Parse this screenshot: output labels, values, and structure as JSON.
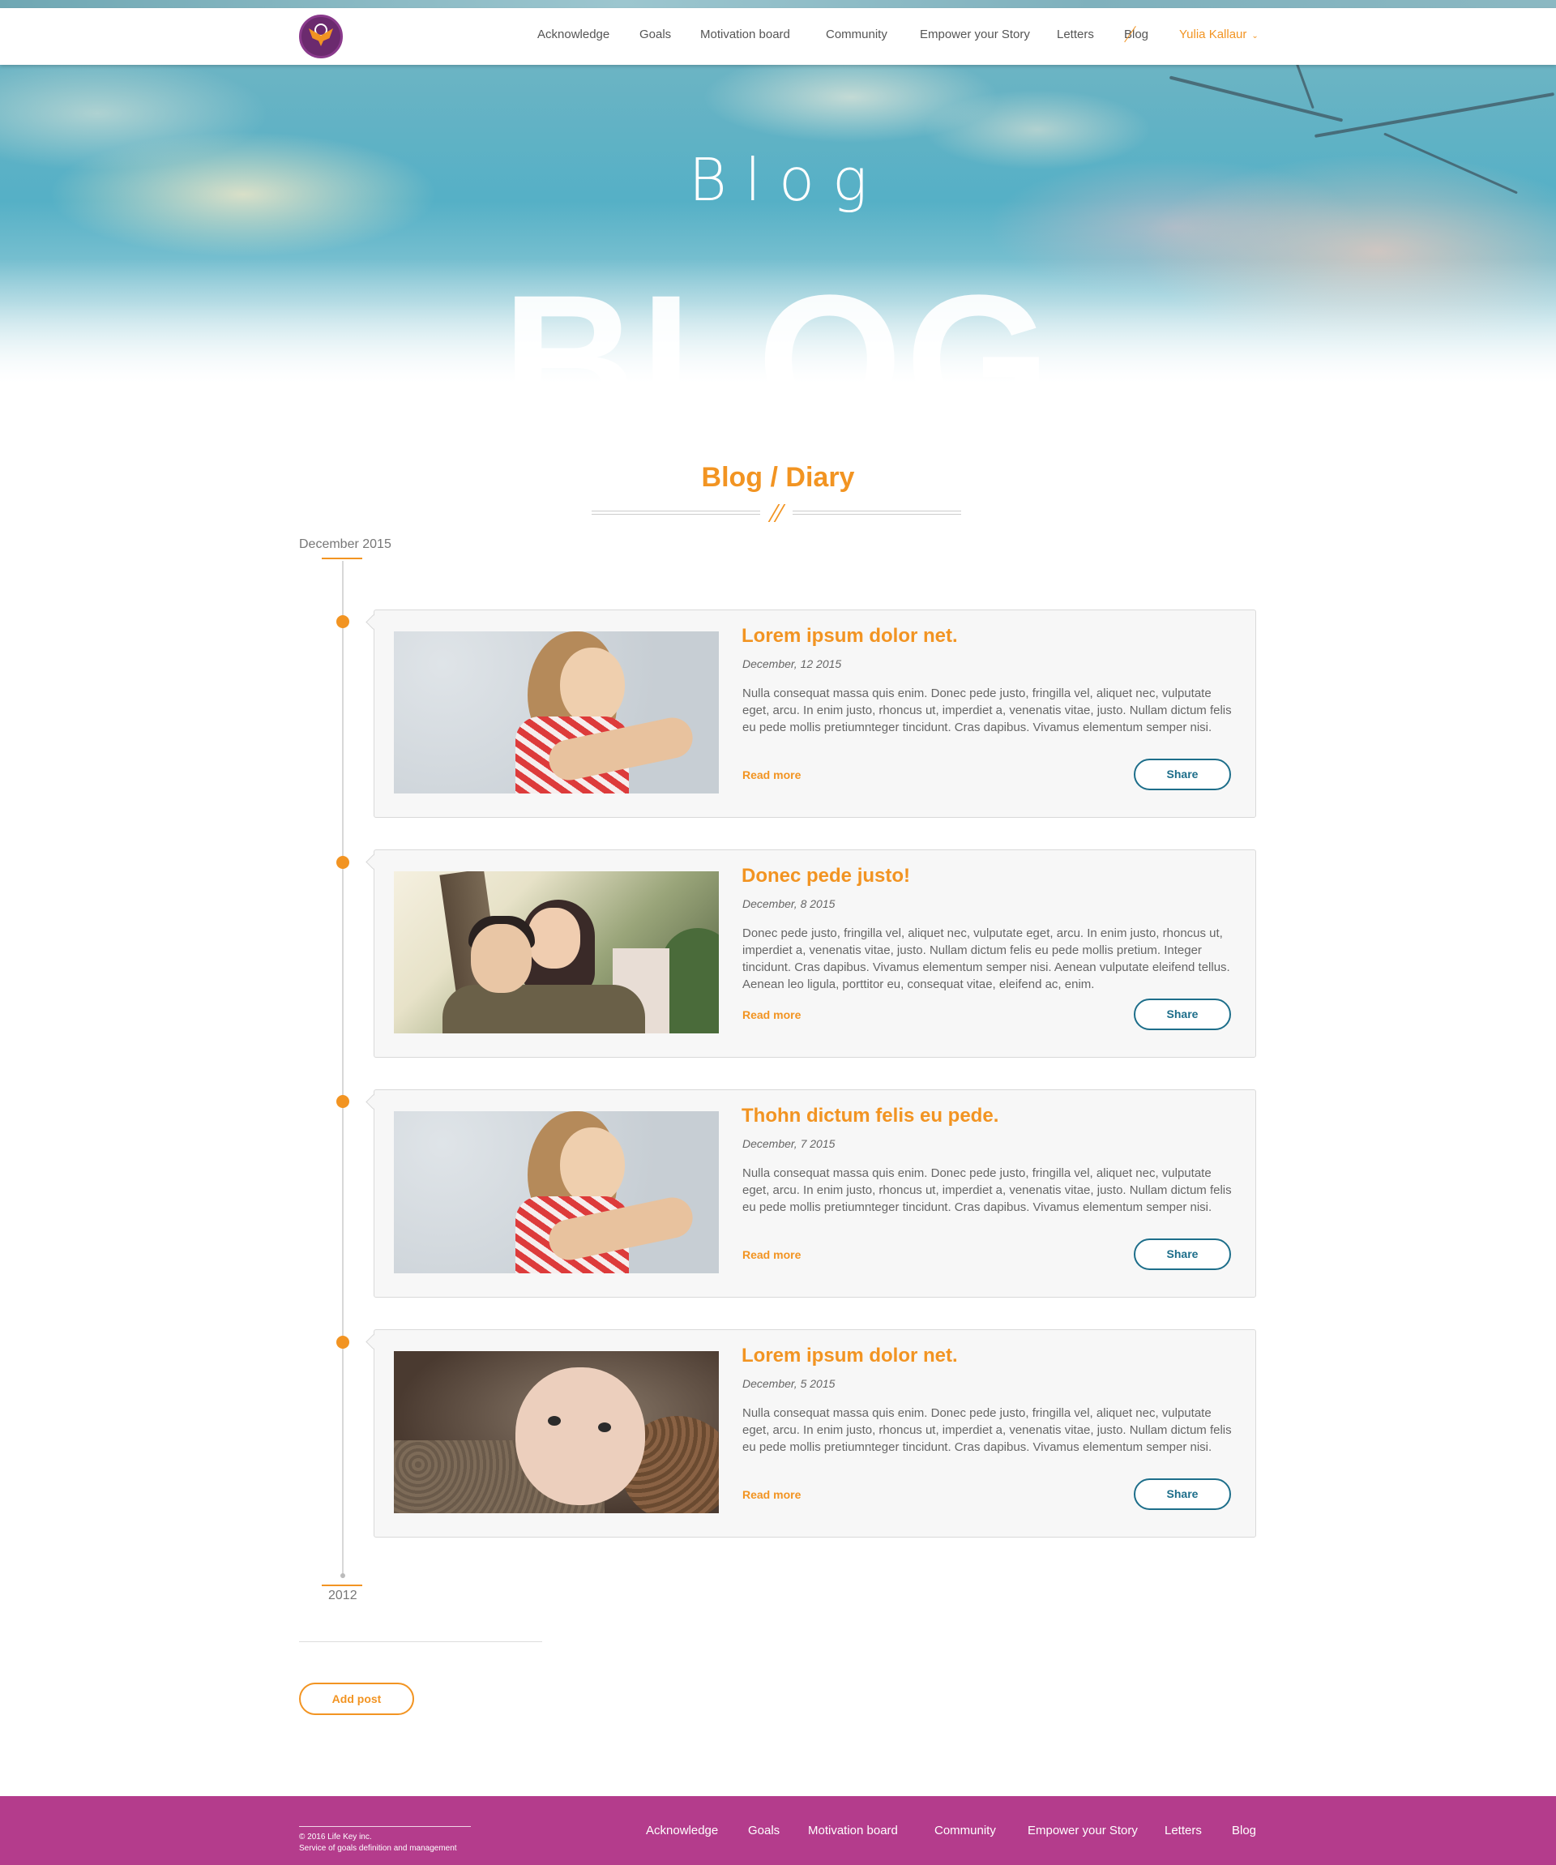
{
  "header": {
    "nav": [
      "Acknowledge",
      "Goals",
      "Motivation board",
      "Community",
      "Empower your Story",
      "Letters",
      "Blog"
    ],
    "active": "Blog",
    "user": "Yulia Kallaur"
  },
  "hero": {
    "title": "Blog",
    "big_text": "BLOG"
  },
  "section": {
    "title": "Blog / Diary",
    "month": "December 2015",
    "year_end": "2012"
  },
  "posts": [
    {
      "title": "Lorem ipsum dolor net.",
      "date": "December, 12  2015",
      "text": "Nulla consequat massa quis enim. Donec pede justo, fringilla vel, aliquet nec, vulputate eget, arcu. In enim justo, rhoncus ut, imperdiet a, venenatis vitae, justo. Nullam dictum felis eu pede mollis pretiumnteger tincidunt. Cras dapibus. Vivamus elementum semper nisi.",
      "read_more": "Read more",
      "share": "Share",
      "image": "girl-photo"
    },
    {
      "title": "Donec pede justo!",
      "date": "December, 8  2015",
      "text": "Donec pede justo, fringilla vel, aliquet nec, vulputate eget, arcu. In enim justo, rhoncus ut, imperdiet a, venenatis vitae, justo. Nullam dictum felis eu pede mollis pretium. Integer tincidunt. Cras dapibus. Vivamus elementum semper nisi. Aenean vulputate eleifend tellus. Aenean leo ligula, porttitor eu, consequat vitae, eleifend ac, enim.",
      "read_more": "Read more",
      "share": "Share",
      "image": "couple-photo"
    },
    {
      "title": "Thohn dictum felis eu pede.",
      "date": "December, 7  2015",
      "text": "Nulla consequat massa quis enim. Donec pede justo, fringilla vel, aliquet nec, vulputate eget, arcu. In enim justo, rhoncus ut, imperdiet a, venenatis vitae, justo. Nullam dictum felis eu pede mollis pretiumnteger tincidunt. Cras dapibus. Vivamus elementum semper nisi.",
      "read_more": "Read more",
      "share": "Share",
      "image": "girl-photo"
    },
    {
      "title": "Lorem ipsum dolor net.",
      "date": "December, 5  2015",
      "text": "Nulla consequat massa quis enim. Donec pede justo, fringilla vel, aliquet nec, vulputate eget, arcu. In enim justo, rhoncus ut, imperdiet a, venenatis vitae, justo. Nullam dictum felis eu pede mollis pretiumnteger tincidunt. Cras dapibus. Vivamus elementum semper nisi.",
      "read_more": "Read more",
      "share": "Share",
      "image": "baby-photo"
    }
  ],
  "actions": {
    "add_post": "Add post"
  },
  "footer": {
    "copyright": "© 2016 Life Key inc.",
    "tagline": "Service of goals definition and management",
    "nav": [
      "Acknowledge",
      "Goals",
      "Motivation board",
      "Community",
      "Empower your Story",
      "Letters",
      "Blog"
    ]
  },
  "colors": {
    "accent": "#f29422",
    "share": "#1d6e8a",
    "footer": "#b43c8c"
  }
}
